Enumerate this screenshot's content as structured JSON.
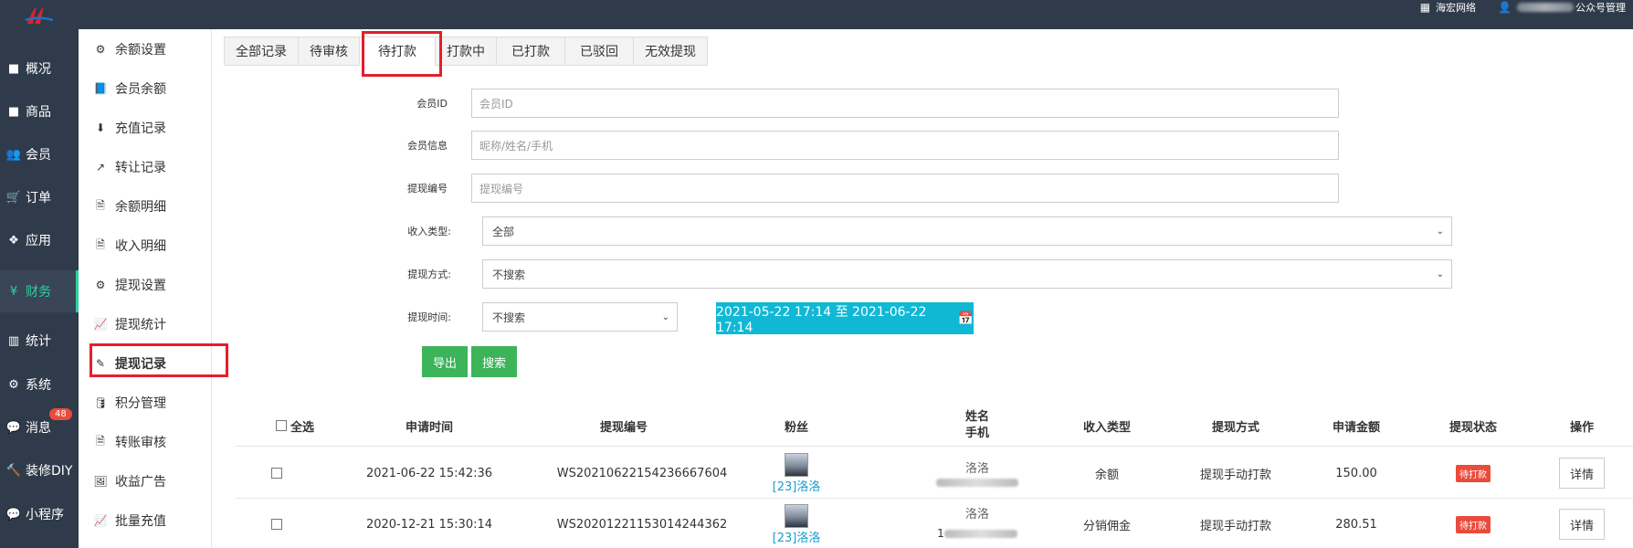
{
  "topbar": {
    "company": "海宏网络",
    "account_suffix": "公众号管理"
  },
  "nav_main": [
    {
      "label": "概况",
      "icon": "square-icon"
    },
    {
      "label": "商品",
      "icon": "square-icon"
    },
    {
      "label": "会员",
      "icon": "users-icon"
    },
    {
      "label": "订单",
      "icon": "cart-icon"
    },
    {
      "label": "应用",
      "icon": "cubes-icon"
    },
    {
      "label": "财务",
      "icon": "yen-icon",
      "active": true
    },
    {
      "label": "统计",
      "icon": "bar-chart-icon"
    },
    {
      "label": "系统",
      "icon": "gears-icon"
    },
    {
      "label": "消息",
      "icon": "comment-icon",
      "badge": "48"
    },
    {
      "label": "装修DIY",
      "icon": "gavel-icon"
    },
    {
      "label": "小程序",
      "icon": "wechat-icon"
    }
  ],
  "nav_sub": [
    {
      "label": "余额设置",
      "icon": "gear-icon"
    },
    {
      "label": "会员余额",
      "icon": "book-icon"
    },
    {
      "label": "充值记录",
      "icon": "download-icon"
    },
    {
      "label": "转让记录",
      "icon": "external-link-icon"
    },
    {
      "label": "余额明细",
      "icon": "file-icon"
    },
    {
      "label": "收入明细",
      "icon": "file-icon"
    },
    {
      "label": "提现设置",
      "icon": "gear-icon"
    },
    {
      "label": "提现统计",
      "icon": "line-chart-icon"
    },
    {
      "label": "提现记录",
      "icon": "pencil-icon",
      "active": true
    },
    {
      "label": "积分管理",
      "icon": "database-icon"
    },
    {
      "label": "转账审核",
      "icon": "file-icon"
    },
    {
      "label": "收益广告",
      "icon": "image-icon"
    },
    {
      "label": "批量充值",
      "icon": "line-chart-icon"
    }
  ],
  "tabs": [
    "全部记录",
    "待审核",
    "待打款",
    "打款中",
    "已打款",
    "已驳回",
    "无效提现"
  ],
  "active_tab": "待打款",
  "form": {
    "member_id_label": "会员ID",
    "member_id_placeholder": "会员ID",
    "member_info_label": "会员信息",
    "member_info_placeholder": "昵称/姓名/手机",
    "withdraw_no_label": "提现编号",
    "withdraw_no_placeholder": "提现编号",
    "income_type_label": "收入类型:",
    "income_type_value": "全部",
    "withdraw_method_label": "提现方式:",
    "withdraw_method_value": "不搜索",
    "withdraw_time_label": "提现时间:",
    "withdraw_time_value": "不搜索",
    "date_range": "2021-05-22 17:14 至 2021-06-22 17:14",
    "export_label": "导出",
    "search_label": "搜索"
  },
  "table": {
    "headers": {
      "select_all": "全选",
      "apply_time": "申请时间",
      "withdraw_no": "提现编号",
      "fans": "粉丝",
      "name": "姓名",
      "phone": "手机",
      "income_type": "收入类型",
      "method": "提现方式",
      "amount": "申请金额",
      "status": "提现状态",
      "action": "操作"
    },
    "rows": [
      {
        "apply_time": "2021-06-22 15:42:36",
        "withdraw_no": "WS20210622154236667604",
        "fan": "[23]洛洛",
        "name": "洛洛",
        "income_type": "余额",
        "method": "提现手动打款",
        "amount": "150.00",
        "status": "待打款",
        "action": "详情"
      },
      {
        "apply_time": "2020-12-21 15:30:14",
        "withdraw_no": "WS20201221153014244362",
        "fan": "[23]洛洛",
        "name": "洛洛",
        "phone_prefix": "1",
        "income_type": "分销佣金",
        "method": "提现手动打款",
        "amount": "280.51",
        "status": "待打款",
        "action": "详情"
      }
    ]
  },
  "colors": {
    "sidebar_bg": "#2f3b4a",
    "accent_teal": "#2fd0a0",
    "date_btn": "#10b8d6",
    "green_btn": "#3cb45a",
    "status_red": "#e94b3c",
    "highlight_red": "#e3202a"
  }
}
